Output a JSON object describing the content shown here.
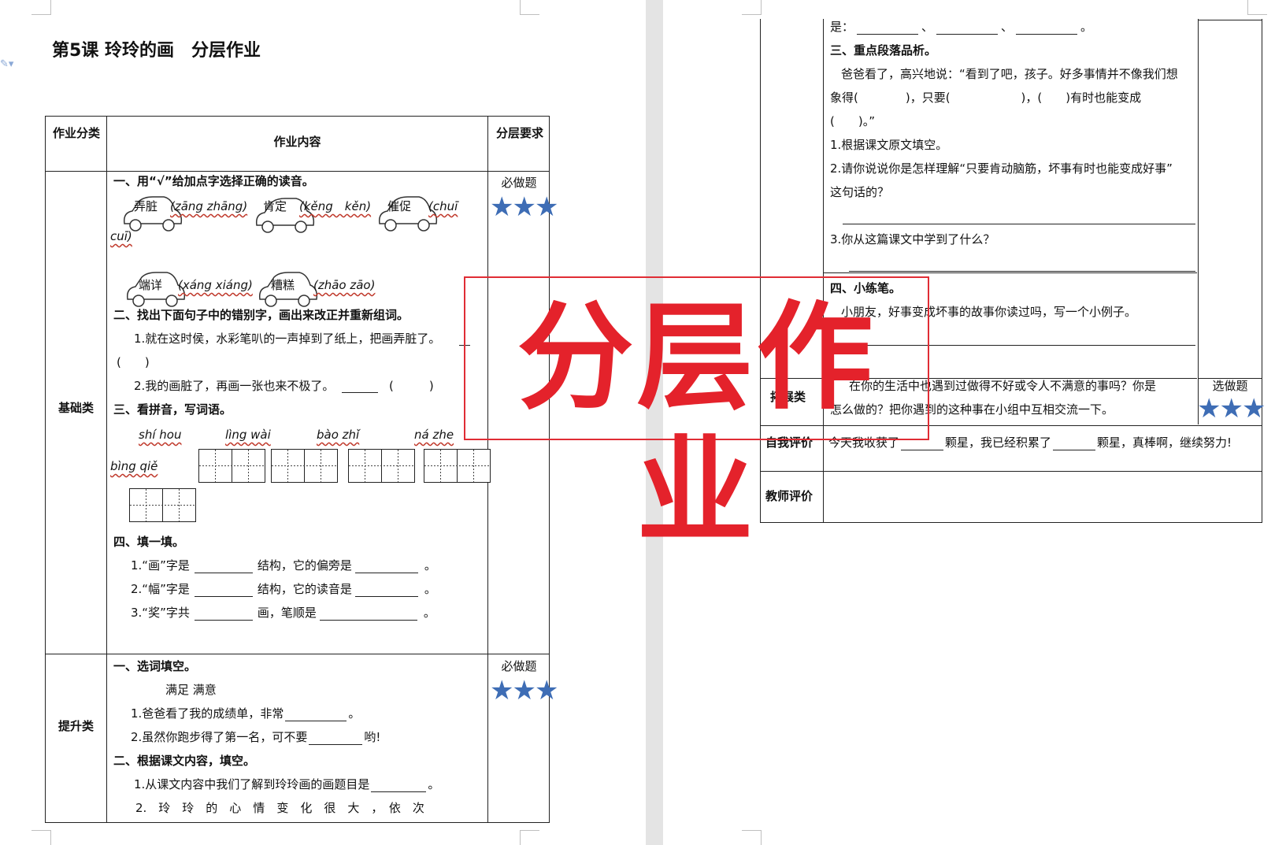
{
  "page1": {
    "title_left": "第5课 玲玲的画",
    "title_right": "分层作业",
    "headers": {
      "category": "作业分类",
      "content": "作业内容",
      "requirement": "分层要求"
    },
    "basic": {
      "category": "基础类",
      "requirement": "必做题",
      "stars": "★★★",
      "q1_title": "一、用“√”给加点字选择正确的读音。",
      "q1_words": [
        "弄脏",
        "肯定",
        "催促",
        "端详",
        "糟糕"
      ],
      "q1_py": [
        "(zāng zhāng)",
        "(kěng　kěn)",
        "(chuī",
        "cuī)",
        "(xáng xiáng)",
        "(zhāo zāo)"
      ],
      "q2_title": "二、找出下面句子中的错别字，画出来改正并重新组词。",
      "q2_s1": "1.就在这时侯，水彩笔叭的一声掉到了纸上，把画弄脏了。",
      "q2_s1b": "(　　)",
      "q2_s2a": "2.我的画脏了，再画一张也来不极了。",
      "q2_s2b": "(　　　)",
      "q3_title": "三、看拼音，写词语。",
      "q3_py": [
        "shí hou",
        "lìng wài",
        "bào zhǐ",
        "ná zhe",
        "bìng qiě"
      ],
      "q4_title": "四、填一填。",
      "q4_lines": [
        [
          "1.“画”字是",
          "结构，它的偏旁是",
          "。"
        ],
        [
          "2.“幅”字是",
          "结构，它的读音是",
          "。"
        ],
        [
          "3.“奖”字共",
          "画，笔顺是",
          "。"
        ]
      ]
    },
    "advanced": {
      "category": "提升类",
      "requirement": "必做题",
      "stars": "★★★",
      "q1_title": "一、选词填空。",
      "q1_words": "满足 满意",
      "q1_s1a": "1.爸爸看了我的成绩单，非常",
      "q1_s1b": "。",
      "q1_s2a": "2.虽然你跑步得了第一名，可不要",
      "q1_s2b": "哟!",
      "q2_title": "二、根据课文内容，填空。",
      "q2_s1a": "1.从课文内容中我们了解到玲玲画的画题目是",
      "q2_s1b": "。",
      "q2_s2": "2.　玲　玲　的　心　情　变　化　很　大　，　依　次"
    }
  },
  "page2": {
    "top_line": [
      "是：",
      "、",
      "、",
      "。"
    ],
    "q3_title": "三、重点段落品析。",
    "q3_para1": "爸爸看了，高兴地说：“看到了吧，孩子。好多事情并不像我们想",
    "q3_para2": "象得(　　　　)，只要(　　　　　　)，(　　)有时也能变成",
    "q3_para3": "(　　)。”",
    "q3_s1": "1.根据课文原文填空。",
    "q3_s2a": "2.请你说说你是怎样理解“只要肯动脑筋，坏事有时也能变成好事”",
    "q3_s2b": "这句话的？",
    "q3_s3": "3.你从这篇课文中学到了什么？",
    "q4_title": "四、小练笔。",
    "q4_text": "小朋友，好事变成坏事的故事你读过吗，写一个小例子。",
    "ext": {
      "category": "拓展类",
      "requirement": "选做题",
      "stars": "★★★",
      "text1": "在你的生活中也遇到过做得不好或令人不满意的事吗？你是",
      "text2": "怎么做的？把你遇到的这种事在小组中互相交流一下。"
    },
    "self_eval": {
      "label": "自我评价",
      "a": "今天我收获了",
      "b": "颗星，我已经积累了",
      "c": "颗星，真棒啊，继续努力!"
    },
    "teacher_eval": {
      "label": "教师评价"
    }
  },
  "stamp": {
    "text": "分层作业",
    "color": "#e4222b"
  },
  "colors": {
    "star": "#3e6db5",
    "pinyin_underline": "#c0392b",
    "gutter": "#e4e4e4"
  }
}
